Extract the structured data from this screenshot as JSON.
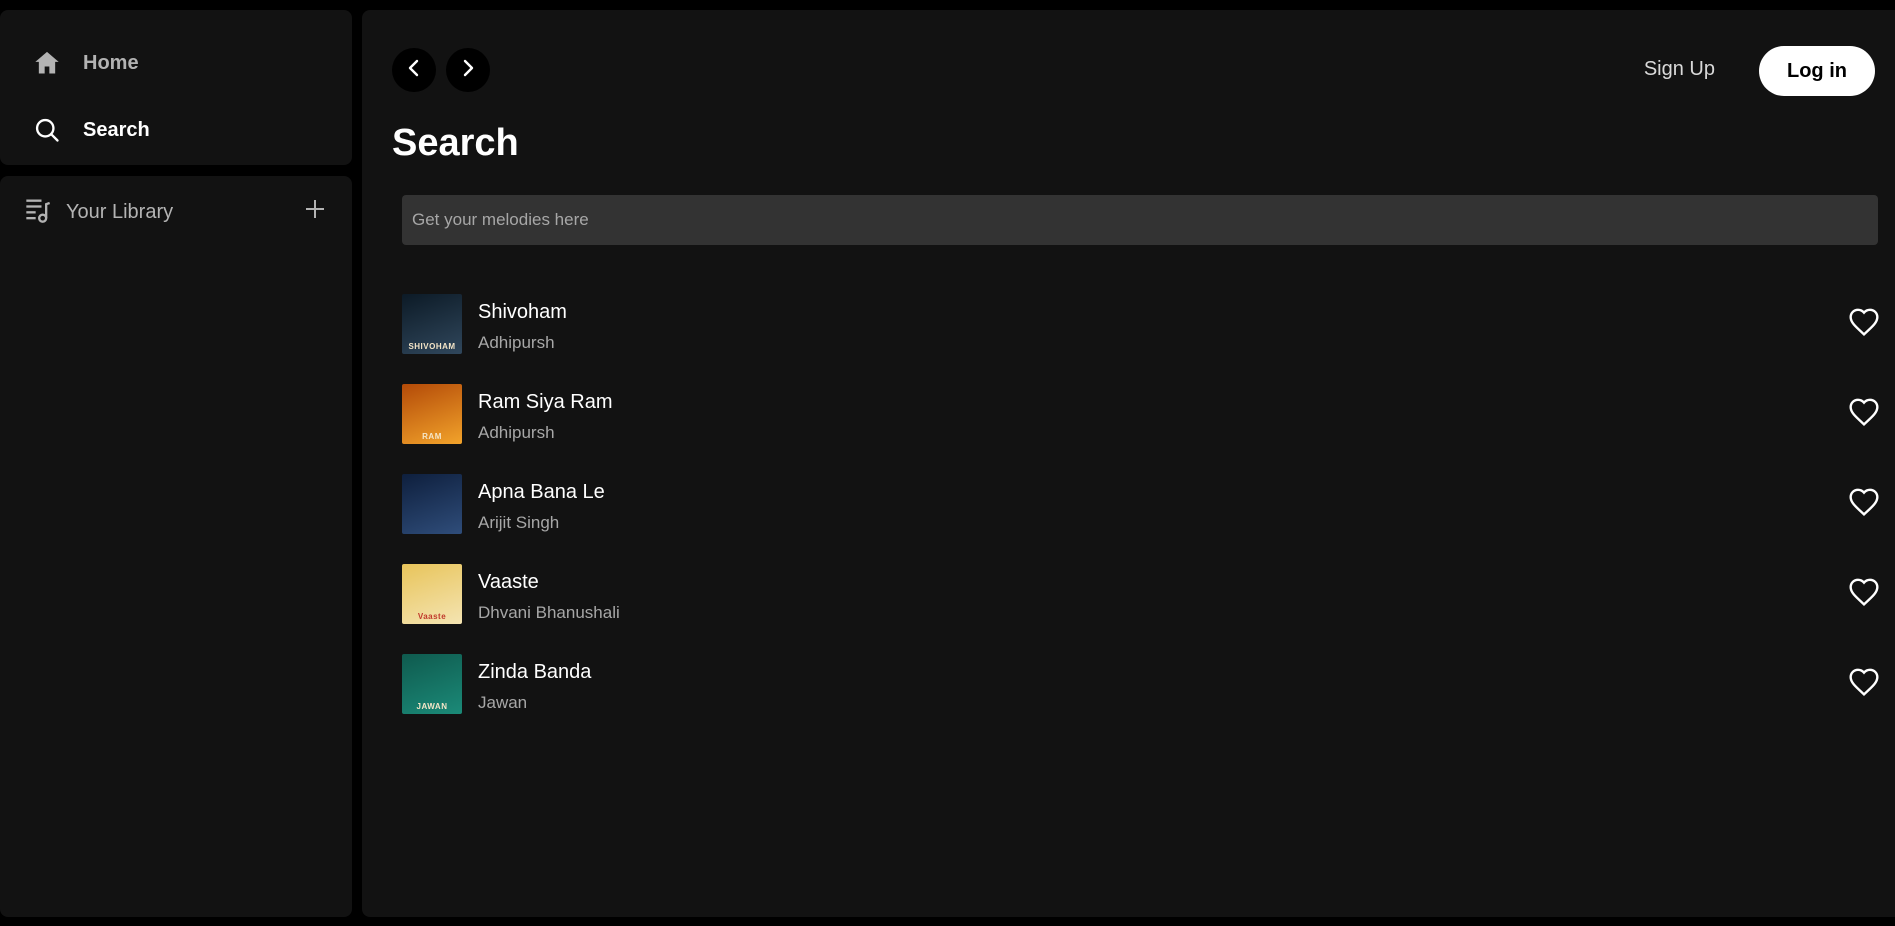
{
  "sidebar": {
    "home_label": "Home",
    "search_label": "Search",
    "library_label": "Your Library"
  },
  "header": {
    "signup_label": "Sign Up",
    "login_label": "Log in"
  },
  "main": {
    "title": "Search",
    "search_placeholder": "Get your melodies here"
  },
  "songs": [
    {
      "title": "Shivoham",
      "artist": "Adhipursh",
      "cover_caption": "SHIVOHAM",
      "cover_colors": [
        "#0c1a26",
        "#30475c"
      ]
    },
    {
      "title": "Ram Siya Ram",
      "artist": "Adhipursh",
      "cover_caption": "RAM",
      "cover_colors": [
        "#b34a08",
        "#f2a32b"
      ]
    },
    {
      "title": "Apna Bana Le",
      "artist": "Arijit Singh",
      "cover_caption": "",
      "cover_colors": [
        "#0e1f3d",
        "#2f4d7a"
      ]
    },
    {
      "title": "Vaaste",
      "artist": "Dhvani Bhanushali",
      "cover_caption": "Vaaste",
      "cover_colors": [
        "#e8c45a",
        "#f4e4b2"
      ]
    },
    {
      "title": "Zinda Banda",
      "artist": "Jawan",
      "cover_caption": "JAWAN",
      "cover_colors": [
        "#0f5a4e",
        "#1b8a78"
      ]
    }
  ],
  "colors": {
    "background": "#000000",
    "panel": "#121212",
    "input": "#333333",
    "muted_text": "#a7a7a7"
  },
  "icons": {
    "home": "home-icon",
    "search": "search-icon",
    "library": "library-icon",
    "add": "plus-icon",
    "back": "chevron-left-icon",
    "forward": "chevron-right-icon",
    "like": "heart-icon"
  }
}
